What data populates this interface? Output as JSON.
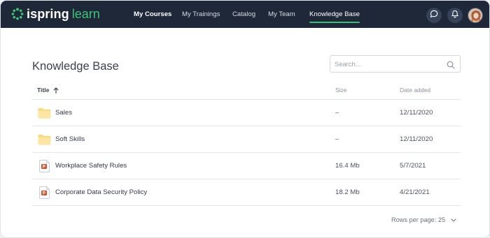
{
  "brand": {
    "word1": "ispring",
    "word2": "learn",
    "accent": "#3cc477"
  },
  "nav": {
    "items": [
      {
        "label": "My Courses",
        "bold": true
      },
      {
        "label": "My Trainings"
      },
      {
        "label": "Catalog"
      },
      {
        "label": "My Team"
      },
      {
        "label": "Knowledge Base",
        "active": true
      }
    ]
  },
  "header_actions": {
    "chat_icon": "chat-bubble-icon",
    "bell_icon": "bell-icon",
    "avatar": "user-avatar"
  },
  "page": {
    "title": "Knowledge Base"
  },
  "search": {
    "placeholder": "Search...",
    "value": ""
  },
  "table": {
    "columns": {
      "title": "Title",
      "size": "Size",
      "date": "Date added"
    },
    "sort": {
      "column": "Title",
      "direction": "ascending"
    },
    "rows": [
      {
        "type": "folder",
        "name": "Sales",
        "size": "–",
        "date": "12/11/2020"
      },
      {
        "type": "folder",
        "name": "Soft Skills",
        "size": "–",
        "date": "12/11/2020"
      },
      {
        "type": "powerpoint",
        "name": "Workplace Safety Rules",
        "size": "16.4 Mb",
        "date": "5/7/2021"
      },
      {
        "type": "powerpoint",
        "name": "Corporate Data Security Policy",
        "size": "18.2 Mb",
        "date": "4/21/2021"
      }
    ]
  },
  "pagination": {
    "rows_per_page_label": "Rows per page: 25"
  }
}
